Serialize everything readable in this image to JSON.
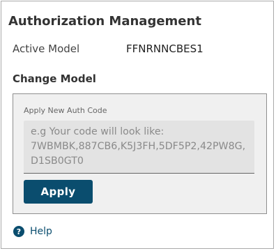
{
  "panel": {
    "title": "Authorization Management"
  },
  "active_model": {
    "label": "Active Model",
    "value": "FFNRNNCBES1"
  },
  "change_model": {
    "title": "Change Model",
    "field_label": "Apply New Auth Code",
    "placeholder": "e.g Your code will look like: 7WBMBK,887CB6,K5J3FH,5DF5P2,42PW8G,D1SB0GT0",
    "value": "",
    "apply_label": "Apply"
  },
  "help": {
    "icon_glyph": "?",
    "label": "Help"
  },
  "colors": {
    "accent": "#0a4d6e",
    "box_background": "#f0f0f0",
    "input_background": "#e3e3e3"
  }
}
